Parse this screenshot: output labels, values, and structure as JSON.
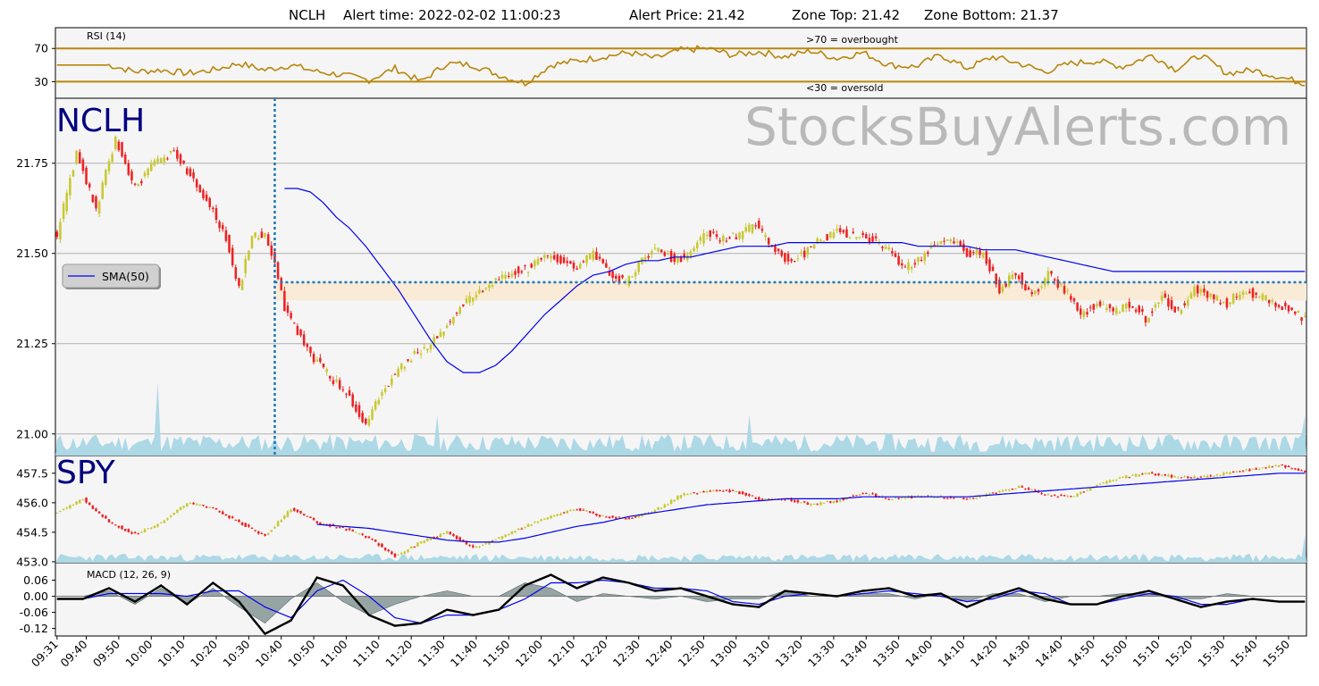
{
  "header": {
    "symbol": "NCLH",
    "alert_time_label": "Alert time: 2022-02-02 11:00:23",
    "alert_price_label": "Alert Price: 21.42",
    "zone_top_label": "Zone Top: 21.42",
    "zone_bottom_label": "Zone Bottom: 21.37"
  },
  "watermark": "StocksBuyAlerts.com",
  "colors": {
    "up_candle": "#c8c832",
    "down_candle": "#ee2222",
    "sma": "#0000ee",
    "rsi": "#b8860b",
    "volume": "#add8e6",
    "zone": "#faebd7",
    "alert_line": "#1f77b4",
    "macd_line": "#000000",
    "signal_line": "#0000ee",
    "histogram": "#7f9090",
    "panel_bg": "#f5f5f5",
    "name_color": "#000080"
  },
  "chart_data": [
    {
      "type": "line",
      "panel": "rsi",
      "title": "RSI (14)",
      "ylim": [
        10,
        95
      ],
      "yticks": [
        "70",
        "30"
      ],
      "thresholds": [
        70,
        30
      ],
      "annotations": [
        ">70 = overbought",
        "<30 = oversold"
      ],
      "x": [
        0,
        8,
        16,
        24,
        32,
        40,
        48,
        56,
        64,
        72,
        80,
        88,
        96,
        104,
        112,
        120,
        128,
        136,
        144,
        152,
        160,
        168,
        176,
        184,
        192,
        200,
        208,
        216,
        224,
        232,
        240,
        248,
        256,
        264,
        272,
        280,
        288,
        296,
        304,
        312,
        320,
        328,
        337,
        344,
        352,
        360,
        368,
        376,
        384
      ],
      "values": [
        50,
        50,
        50,
        42,
        44,
        40,
        44,
        52,
        44,
        50,
        42,
        38,
        32,
        46,
        30,
        52,
        50,
        38,
        28,
        50,
        55,
        60,
        65,
        58,
        68,
        70,
        62,
        66,
        60,
        67,
        58,
        65,
        50,
        48,
        62,
        46,
        60,
        52,
        42,
        52,
        55,
        48,
        62,
        45,
        62,
        40,
        44,
        36,
        28
      ]
    },
    {
      "type": "line",
      "panel": "price",
      "title": "NCLH",
      "ylim": [
        20.94,
        21.93
      ],
      "yticks": [
        "21.75",
        "21.50",
        "21.25",
        "21.00"
      ],
      "legend": "SMA(50)",
      "zone": {
        "top": 21.42,
        "bottom": 21.37
      },
      "alert_bar": 67,
      "alert_price": 21.42,
      "x": [
        0,
        6,
        12,
        18,
        24,
        30,
        36,
        42,
        48,
        52,
        56,
        60,
        64,
        67,
        70,
        74,
        78,
        82,
        86,
        90,
        95,
        100,
        105,
        110,
        115,
        120,
        125,
        130,
        135,
        140,
        145,
        150,
        155,
        160,
        165,
        170,
        175,
        180,
        185,
        190,
        195,
        200,
        205,
        210,
        215,
        220,
        225,
        230,
        235,
        240,
        245,
        250,
        255,
        260,
        265,
        270,
        275,
        280,
        285,
        290,
        295,
        300,
        305,
        310,
        315,
        320,
        325,
        330,
        335,
        340,
        345,
        350,
        355,
        360,
        365,
        370,
        375,
        380,
        384
      ],
      "values": [
        21.55,
        21.78,
        21.62,
        21.82,
        21.68,
        21.75,
        21.78,
        21.7,
        21.62,
        21.54,
        21.4,
        21.55,
        21.55,
        21.48,
        21.35,
        21.28,
        21.22,
        21.18,
        21.14,
        21.1,
        21.02,
        21.12,
        21.18,
        21.22,
        21.25,
        21.3,
        21.36,
        21.4,
        21.42,
        21.45,
        21.46,
        21.5,
        21.48,
        21.46,
        21.5,
        21.44,
        21.42,
        21.48,
        21.52,
        21.48,
        21.5,
        21.56,
        21.54,
        21.55,
        21.58,
        21.52,
        21.48,
        21.5,
        21.54,
        21.56,
        21.55,
        21.54,
        21.52,
        21.46,
        21.48,
        21.52,
        21.54,
        21.5,
        21.5,
        21.4,
        21.45,
        21.38,
        21.44,
        21.4,
        21.33,
        21.36,
        21.34,
        21.36,
        21.32,
        21.38,
        21.34,
        21.4,
        21.38,
        21.36,
        21.4,
        21.38,
        21.36,
        21.34,
        21.32
      ],
      "sma": [
        null,
        null,
        null,
        null,
        null,
        null,
        null,
        null,
        null,
        null,
        null,
        null,
        null,
        null,
        21.68,
        21.68,
        21.67,
        21.64,
        21.6,
        21.57,
        21.52,
        21.46,
        21.4,
        21.33,
        21.26,
        21.2,
        21.17,
        21.17,
        21.19,
        21.23,
        21.28,
        21.33,
        21.37,
        21.41,
        21.44,
        21.45,
        21.47,
        21.48,
        21.48,
        21.49,
        21.49,
        21.5,
        21.51,
        21.52,
        21.52,
        21.52,
        21.53,
        21.53,
        21.53,
        21.53,
        21.53,
        21.53,
        21.53,
        21.53,
        21.52,
        21.52,
        21.52,
        21.52,
        21.51,
        21.51,
        21.51,
        21.5,
        21.49,
        21.48,
        21.47,
        21.46,
        21.45,
        21.45,
        21.45,
        21.45,
        21.45,
        21.45,
        21.45,
        21.45,
        21.45,
        21.45,
        21.45,
        21.45,
        21.45
      ]
    },
    {
      "type": "line",
      "panel": "spy",
      "title": "SPY",
      "ylim": [
        452.95,
        458.4
      ],
      "yticks": [
        "457.5",
        "456.0",
        "454.5",
        "453.0"
      ],
      "x": [
        0,
        8,
        16,
        24,
        32,
        40,
        48,
        56,
        64,
        72,
        80,
        88,
        96,
        104,
        112,
        120,
        128,
        136,
        144,
        152,
        160,
        168,
        176,
        184,
        192,
        200,
        208,
        216,
        224,
        232,
        240,
        248,
        256,
        264,
        272,
        280,
        288,
        296,
        304,
        312,
        320,
        328,
        336,
        344,
        352,
        360,
        368,
        376,
        384
      ],
      "values": [
        455.5,
        456.2,
        455.0,
        454.4,
        455.0,
        456.0,
        455.7,
        455.0,
        454.3,
        455.7,
        455.0,
        454.7,
        454.2,
        453.3,
        454.0,
        454.5,
        453.7,
        454.2,
        454.8,
        455.3,
        455.7,
        455.3,
        455.2,
        455.6,
        456.4,
        456.6,
        456.6,
        456.2,
        456.2,
        455.9,
        456.1,
        456.5,
        456.2,
        456.3,
        456.3,
        456.2,
        456.5,
        456.8,
        456.4,
        456.3,
        456.9,
        457.3,
        457.5,
        457.3,
        457.3,
        457.5,
        457.7,
        457.9,
        457.6
      ],
      "sma": [
        null,
        null,
        null,
        null,
        null,
        null,
        null,
        null,
        null,
        null,
        454.9,
        454.8,
        454.7,
        454.5,
        454.3,
        454.1,
        454.0,
        454.0,
        454.2,
        454.5,
        454.8,
        455.0,
        455.3,
        455.5,
        455.7,
        455.9,
        456.0,
        456.1,
        456.2,
        456.2,
        456.2,
        456.3,
        456.3,
        456.3,
        456.3,
        456.3,
        456.4,
        456.5,
        456.6,
        456.7,
        456.8,
        456.9,
        457.0,
        457.1,
        457.2,
        457.3,
        457.4,
        457.5,
        457.5
      ]
    },
    {
      "type": "line",
      "panel": "macd",
      "title": "MACD (12, 26, 9)",
      "ylim": [
        -0.148,
        0.125
      ],
      "yticks": [
        "0.06",
        "0.00",
        "-0.06",
        "-0.12"
      ],
      "x": [
        0,
        8,
        16,
        24,
        32,
        40,
        48,
        56,
        64,
        72,
        80,
        88,
        96,
        104,
        112,
        120,
        128,
        136,
        144,
        152,
        160,
        168,
        176,
        184,
        192,
        200,
        208,
        216,
        224,
        232,
        240,
        248,
        256,
        264,
        272,
        280,
        288,
        296,
        304,
        312,
        320,
        328,
        336,
        344,
        352,
        360,
        368,
        376,
        384
      ],
      "macd": [
        -0.01,
        -0.01,
        0.03,
        -0.02,
        0.04,
        -0.03,
        0.05,
        -0.02,
        -0.14,
        -0.09,
        0.07,
        0.04,
        -0.07,
        -0.11,
        -0.1,
        -0.05,
        -0.07,
        -0.05,
        0.04,
        0.08,
        0.03,
        0.07,
        0.05,
        0.02,
        0.03,
        0.0,
        -0.03,
        -0.04,
        0.02,
        0.01,
        0.0,
        0.02,
        0.03,
        0.0,
        0.01,
        -0.04,
        0.0,
        0.03,
        -0.01,
        -0.03,
        -0.03,
        0.0,
        0.02,
        -0.01,
        -0.04,
        -0.02,
        -0.01,
        -0.02,
        -0.02
      ],
      "signal": [
        -0.01,
        -0.01,
        0.01,
        0.01,
        0.01,
        0.0,
        0.02,
        0.02,
        -0.04,
        -0.08,
        0.02,
        0.06,
        0.0,
        -0.08,
        -0.1,
        -0.07,
        -0.07,
        -0.05,
        -0.01,
        0.05,
        0.05,
        0.06,
        0.05,
        0.03,
        0.03,
        0.02,
        -0.02,
        -0.03,
        0.0,
        0.01,
        0.0,
        0.01,
        0.02,
        0.01,
        0.0,
        -0.02,
        -0.01,
        0.02,
        0.01,
        -0.03,
        -0.03,
        -0.01,
        0.01,
        0.0,
        -0.03,
        -0.03,
        -0.01,
        -0.02,
        -0.02
      ]
    }
  ],
  "x_axis": {
    "first_label": "09:31",
    "labels": [
      "09:40",
      "09:50",
      "10:00",
      "10:10",
      "10:20",
      "10:30",
      "10:40",
      "10:50",
      "11:00",
      "11:10",
      "11:20",
      "11:30",
      "11:40",
      "11:50",
      "12:00",
      "12:10",
      "12:20",
      "12:30",
      "12:40",
      "12:50",
      "13:00",
      "13:10",
      "13:20",
      "13:30",
      "13:40",
      "13:50",
      "14:00",
      "14:10",
      "14:20",
      "14:30",
      "14:40",
      "14:50",
      "15:00",
      "15:10",
      "15:20",
      "15:30",
      "15:40",
      "15:50"
    ]
  }
}
